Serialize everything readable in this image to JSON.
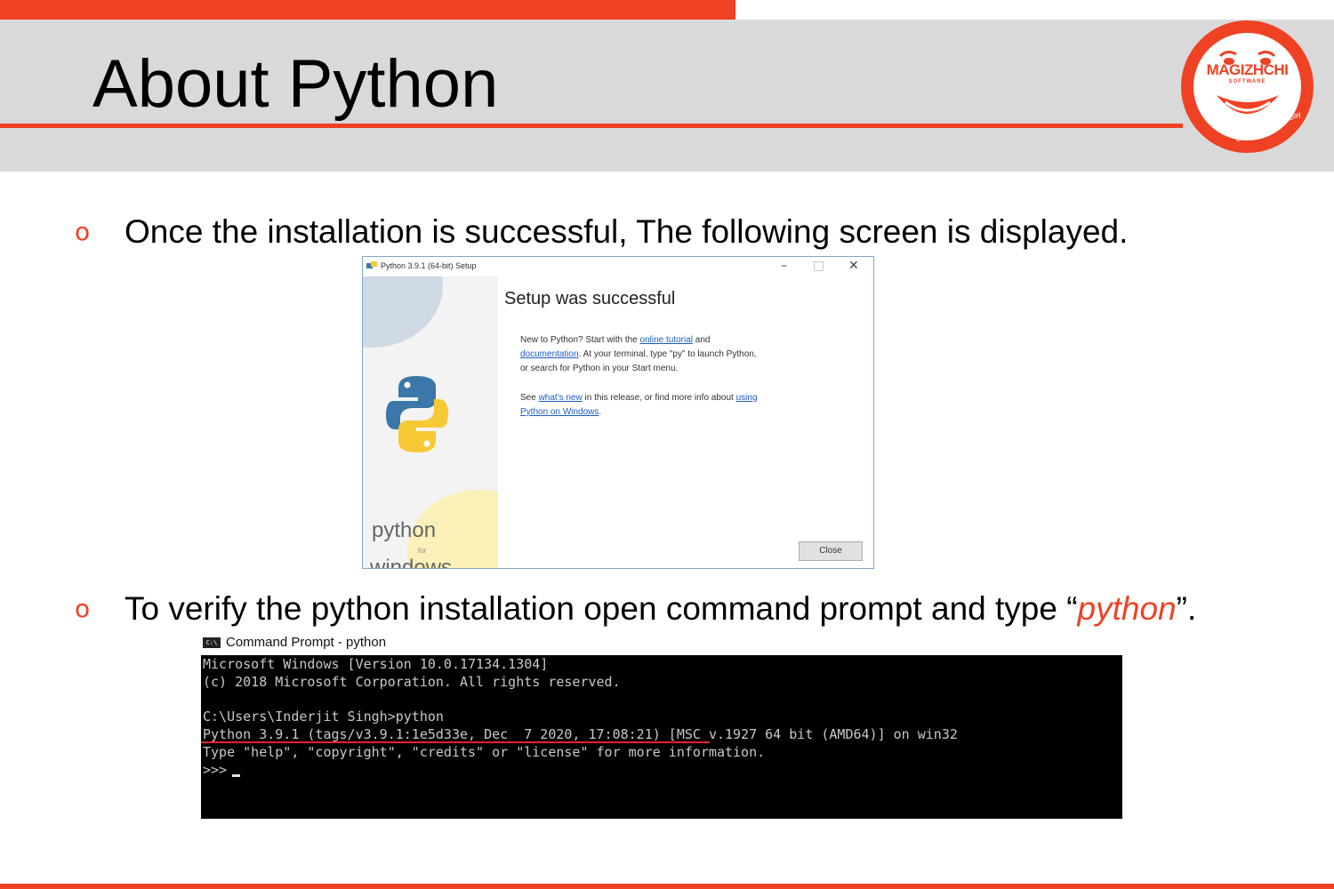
{
  "slide": {
    "title": "About Python",
    "bullet_marker": "o",
    "bullets": [
      {
        "text": "Once the installation is successful, The following screen is displayed."
      },
      {
        "text_before": "To verify the python installation open command prompt and type “",
        "highlight": "python",
        "text_after": "”."
      }
    ]
  },
  "logo": {
    "brand": "MAGIZHCHI",
    "sub": "SOFTWARE",
    "tagline": "Every Day Happy Day"
  },
  "installer": {
    "window_title": "Python 3.9.1 (64-bit) Setup",
    "minimize": "–",
    "maximize": "□",
    "close": "✕",
    "heading": "Setup was successful",
    "p1_line1_a": "New to Python? Start with the ",
    "p1_link1": "online tutorial",
    "p1_line1_b": " and",
    "p1_link2": "documentation",
    "p1_line2": ". At your terminal, type \"py\" to launch Python,",
    "p1_line3": "or search for Python in your Start menu.",
    "p2_a": "See ",
    "p2_link1": "what's new",
    "p2_b": " in this release, or find more info about ",
    "p2_link2a": "using",
    "p2_link2b": "Python on Windows",
    "p2_end": ".",
    "side_word1": "python",
    "side_for": "for",
    "side_word2": "windows",
    "close_button": "Close"
  },
  "cmd": {
    "icon_text": "C:\\",
    "window_title": "Command Prompt - python",
    "lines": [
      "Microsoft Windows [Version 10.0.17134.1304]",
      "(c) 2018 Microsoft Corporation. All rights reserved.",
      "",
      "C:\\Users\\Inderjit Singh>python",
      "Python 3.9.1 (tags/v3.9.1:1e5d33e, Dec  7 2020, 17:08:21) [MSC v.1927 64 bit (AMD64)] on win32",
      "Type \"help\", \"copyright\", \"credits\" or \"license\" for more information.",
      ">>>"
    ]
  },
  "colors": {
    "accent": "#ef4123",
    "header_bg": "#d9d9d9",
    "terminal_bg": "#000000",
    "link": "#1a5bc4",
    "python_blue": "#3b77a8",
    "python_yellow": "#f7c935"
  }
}
